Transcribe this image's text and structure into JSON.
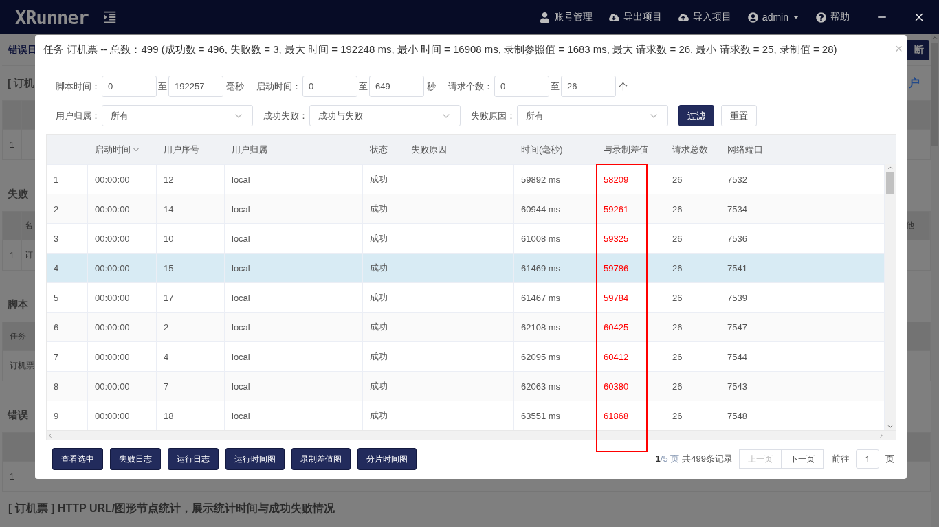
{
  "nav": {
    "logo": "XRunner",
    "items": [
      {
        "kind": "account",
        "label": "账号管理"
      },
      {
        "kind": "export",
        "label": "导出项目"
      },
      {
        "kind": "import",
        "label": "导入项目"
      },
      {
        "kind": "user",
        "label": "admin"
      },
      {
        "kind": "help",
        "label": "帮助"
      }
    ]
  },
  "background": {
    "toolbar": {
      "label": "错误日",
      "button": "断"
    },
    "sections": [
      {
        "kind": "numbered",
        "heading": "[ 订机",
        "link": "户",
        "row": [
          "1"
        ]
      },
      {
        "kind": "numbered",
        "heading": "失败",
        "header": [
          "名"
        ],
        "header_end": "他",
        "row": [
          "1",
          "订"
        ]
      },
      {
        "kind": "plain",
        "heading": "脚本",
        "header": [
          "任务"
        ],
        "row": [
          "订机票"
        ]
      },
      {
        "kind": "wide",
        "heading": "错误",
        "row": [
          "1"
        ]
      }
    ],
    "footer_heading": "[ 订机票 ] HTTP URL/图形节点统计，展示统计时间与成功失败情况"
  },
  "dialog": {
    "title": "任务 订机票 -- 总数：499 (成功数 = 496, 失败数 = 3, 最大 时间 = 192248 ms, 最小 时间 = 16908 ms, 录制参照值 = 1683 ms, 最大 请求数 = 26, 最小 请求数 = 25, 录制值 = 28)",
    "close": "×",
    "ranges": [
      {
        "label": "脚本时间：",
        "from": "0",
        "separator": "至",
        "to": "192257",
        "unit": "毫秒"
      },
      {
        "label": "启动时间：",
        "from": "0",
        "separator": "至",
        "to": "649",
        "unit": "秒"
      },
      {
        "label": "请求个数：",
        "from": "0",
        "separator": "至",
        "to": "26",
        "unit": "个"
      }
    ],
    "selects": [
      {
        "label": "用户归属：",
        "value": "所有"
      },
      {
        "label": "成功失败：",
        "value": "成功与失败"
      },
      {
        "label": "失败原因：",
        "value": "所有"
      }
    ],
    "filter_button": "过滤",
    "reset_button": "重置",
    "table": {
      "columns": [
        {
          "label": "启动时间",
          "sorted": true,
          "highlighted": false
        },
        {
          "label": "用户序号",
          "sorted": false,
          "highlighted": false
        },
        {
          "label": "用户归属",
          "sorted": false,
          "highlighted": false
        },
        {
          "label": "状态",
          "sorted": false,
          "highlighted": false
        },
        {
          "label": "失败原因",
          "sorted": false,
          "highlighted": false
        },
        {
          "label": "时间(毫秒)",
          "sorted": false,
          "highlighted": false
        },
        {
          "label": "与录制差值",
          "sorted": false,
          "highlighted": true
        },
        {
          "label": "请求总数",
          "sorted": false,
          "highlighted": false
        },
        {
          "label": "网络端口",
          "sorted": false,
          "highlighted": false
        }
      ],
      "rows": [
        {
          "selected": false,
          "index": "1",
          "start": "00:00:00",
          "user_no": "12",
          "owner": "local",
          "status": "成功",
          "time": "59892 ms",
          "diff": "58209",
          "requests": "26",
          "port": "7532"
        },
        {
          "selected": false,
          "index": "2",
          "start": "00:00:00",
          "user_no": "14",
          "owner": "local",
          "status": "成功",
          "time": "60944 ms",
          "diff": "59261",
          "requests": "26",
          "port": "7534"
        },
        {
          "selected": false,
          "index": "3",
          "start": "00:00:00",
          "user_no": "10",
          "owner": "local",
          "status": "成功",
          "time": "61008 ms",
          "diff": "59325",
          "requests": "26",
          "port": "7536"
        },
        {
          "selected": true,
          "index": "4",
          "start": "00:00:00",
          "user_no": "15",
          "owner": "local",
          "status": "成功",
          "time": "61469 ms",
          "diff": "59786",
          "requests": "26",
          "port": "7541"
        },
        {
          "selected": false,
          "index": "5",
          "start": "00:00:00",
          "user_no": "17",
          "owner": "local",
          "status": "成功",
          "time": "61467 ms",
          "diff": "59784",
          "requests": "26",
          "port": "7539"
        },
        {
          "selected": false,
          "index": "6",
          "start": "00:00:00",
          "user_no": "2",
          "owner": "local",
          "status": "成功",
          "time": "62108 ms",
          "diff": "60425",
          "requests": "26",
          "port": "7547"
        },
        {
          "selected": false,
          "index": "7",
          "start": "00:00:00",
          "user_no": "4",
          "owner": "local",
          "status": "成功",
          "time": "62095 ms",
          "diff": "60412",
          "requests": "26",
          "port": "7544"
        },
        {
          "selected": false,
          "index": "8",
          "start": "00:00:00",
          "user_no": "7",
          "owner": "local",
          "status": "成功",
          "time": "62063 ms",
          "diff": "60380",
          "requests": "26",
          "port": "7543"
        },
        {
          "selected": false,
          "index": "9",
          "start": "00:00:00",
          "user_no": "18",
          "owner": "local",
          "status": "成功",
          "time": "63551 ms",
          "diff": "61868",
          "requests": "26",
          "port": "7548"
        }
      ]
    },
    "actions": [
      "查看选中",
      "失败日志",
      "运行日志",
      "运行时间图",
      "录制差值图",
      "分片时间图"
    ],
    "pagination": {
      "summary": "**1**/5 页",
      "total": "共499条记录",
      "prev": {
        "label": "上一页",
        "disabled": true
      },
      "next": {
        "label": "下一页",
        "disabled": false
      },
      "goto": "前往",
      "page": "1",
      "unit": "页"
    }
  }
}
